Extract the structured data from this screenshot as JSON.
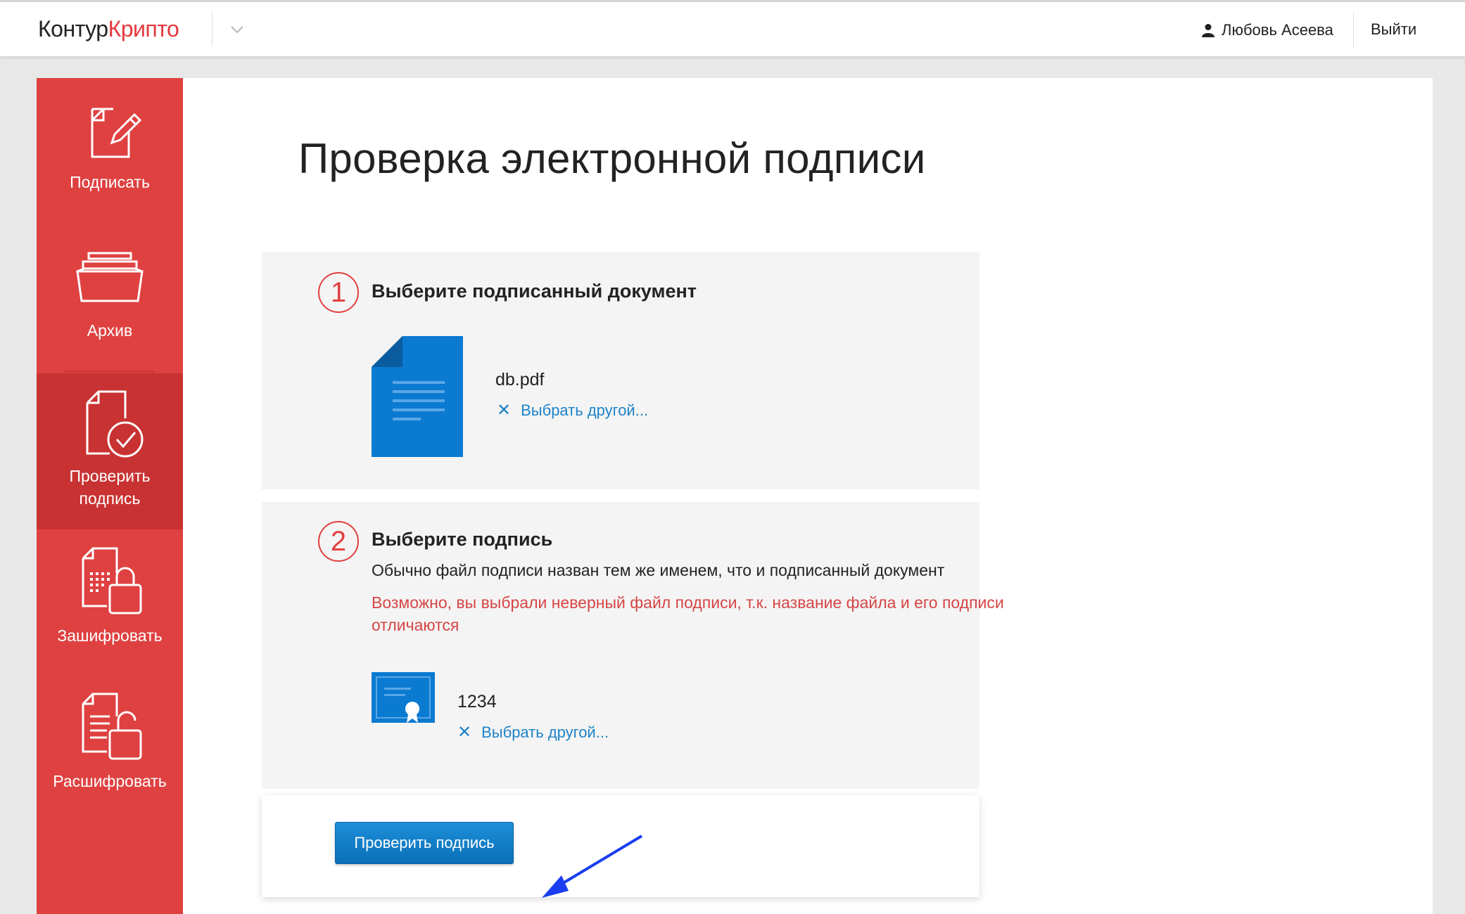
{
  "header": {
    "logo_part1": "Контур",
    "logo_part2": "Крипто",
    "user_name": "Любовь Асеева",
    "logout_label": "Выйти"
  },
  "sidebar": {
    "items": [
      {
        "label": "Подписать",
        "icon": "sign-document-icon"
      },
      {
        "label": "Архив",
        "icon": "archive-tray-icon"
      },
      {
        "label": "Проверить подпись",
        "icon": "verify-document-icon",
        "active": true
      },
      {
        "label": "Зашифровать",
        "icon": "encrypt-lock-icon"
      },
      {
        "label": "Расшифровать",
        "icon": "decrypt-unlock-icon"
      }
    ]
  },
  "main": {
    "title": "Проверка электронной подписи",
    "step1": {
      "number": "1",
      "title": "Выберите подписанный документ",
      "file_name": "db.pdf",
      "choose_other": "Выбрать другой..."
    },
    "step2": {
      "number": "2",
      "title": "Выберите подпись",
      "hint": "Обычно файл подписи назван тем же именем, что и подписанный документ",
      "warning": "Возможно, вы выбрали неверный файл подписи, т.к. название файла и его подписи отличаются",
      "file_name": "1234",
      "choose_other": "Выбрать другой..."
    },
    "submit_label": "Проверить подпись"
  },
  "colors": {
    "brand_red": "#df4141",
    "active_red": "#c93232",
    "link_blue": "#1d83c8",
    "warning_red": "#d64545",
    "button_blue": "#0b6fb8"
  }
}
